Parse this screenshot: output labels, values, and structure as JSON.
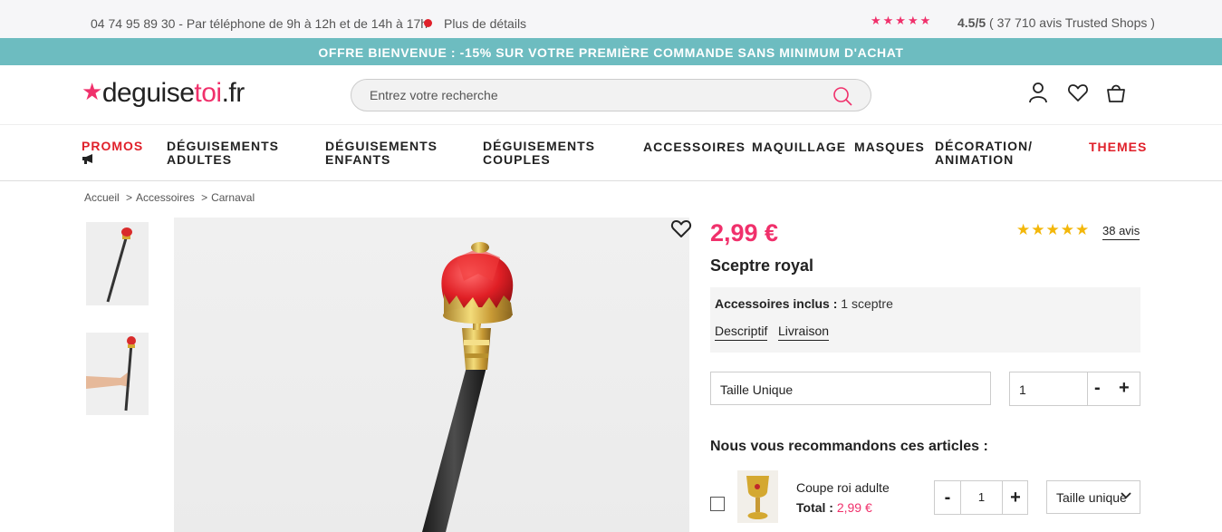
{
  "topbar": {
    "phone": "04 74 95 89 30 - Par téléphone de 9h à 12h et de 14h à 17h",
    "details": "Plus de détails",
    "stars": "★★★★★",
    "rating_score": "4.5/5",
    "rating_text": " ( 37 710 avis Trusted Shops )"
  },
  "promo_banner": "OFFRE BIENVENUE : -15% SUR VOTRE PREMIÈRE COMMANDE SANS MINIMUM D'ACHAT",
  "logo": {
    "part1": "deguise",
    "part2": "toi",
    "part3": ".fr"
  },
  "search": {
    "placeholder": "Entrez votre recherche"
  },
  "nav": {
    "promos": "PROMOS",
    "adultes_l1": "DÉGUISEMENTS",
    "adultes_l2": "ADULTES",
    "enfants_l1": "DÉGUISEMENTS",
    "enfants_l2": "ENFANTS",
    "couples_l1": "DÉGUISEMENTS",
    "couples_l2": "COUPLES",
    "accessoires": "ACCESSOIRES",
    "maquillage": "MAQUILLAGE",
    "masques": "MASQUES",
    "decoration_l1": "DÉCORATION/",
    "decoration_l2": "ANIMATION",
    "themes": "THEMES"
  },
  "breadcrumb": {
    "home": "Accueil",
    "sep1": ">",
    "cat": "Accessoires",
    "sep2": ">",
    "sub": "Carnaval"
  },
  "product": {
    "price": "2,99 €",
    "stars": "★★★★★",
    "reviews": "38 avis",
    "title": "Sceptre royal",
    "accessories_label": "Accessoires inclus :",
    "accessories_value": " 1 sceptre",
    "tab_description": "Descriptif",
    "tab_delivery": "Livraison",
    "size": "Taille Unique",
    "quantity": "1",
    "minus": "-",
    "plus": "+"
  },
  "recommend": {
    "heading": "Nous vous recommandons ces articles :",
    "item_name": "Coupe roi adulte",
    "total_label": "Total : ",
    "total_price": "2,99 €",
    "quantity": "1",
    "minus": "-",
    "plus": "+",
    "size": "Taille unique"
  },
  "colors": {
    "brand_pink": "#f0306b",
    "banner_teal": "#6dbcc0",
    "rating_gold": "#f3b70a"
  }
}
